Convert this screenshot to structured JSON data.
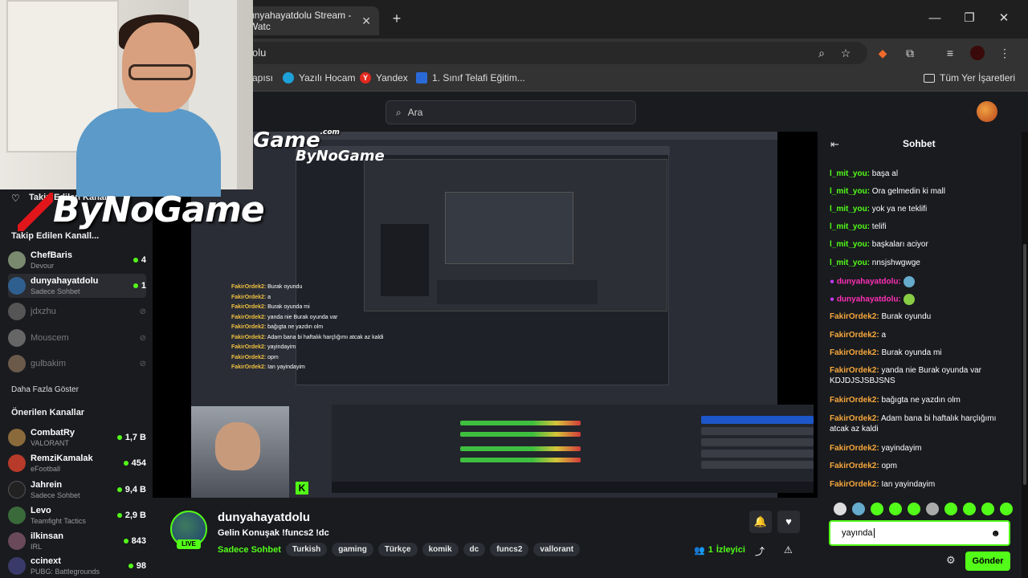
{
  "browser": {
    "tab_title": "unyahayatdolu Stream - Watc",
    "address": "olu",
    "bookmarks": [
      "apısı",
      "Yazılı Hocam",
      "Yandex",
      "1. Sınıf Telafi Eğitim...",
      "Tüm Yer İşaretleri"
    ]
  },
  "header": {
    "search_placeholder": "Ara"
  },
  "overlay": {
    "brand": "ByNoGame",
    "small_logo": "Game",
    "small_logo_com": ".com"
  },
  "sidebar": {
    "followed_title_overlay": "Takip Edilen Kanallar",
    "followed_title": "Takip Edilen Kanall...",
    "followed": [
      {
        "name": "ChefBaris",
        "sub": "Devour",
        "count": "4",
        "live": true,
        "avatar_color": "#7a8a6f"
      },
      {
        "name": "dunyahayatdolu",
        "sub": "Sadece Sohbet",
        "count": "1",
        "live": true,
        "avatar_color": "#2f5f8f"
      },
      {
        "name": "jdxzhu",
        "sub": "",
        "count": "",
        "live": false,
        "avatar_color": "#555"
      },
      {
        "name": "Mouscem",
        "sub": "",
        "count": "",
        "live": false,
        "avatar_color": "#666"
      },
      {
        "name": "gulbakim",
        "sub": "",
        "count": "",
        "live": false,
        "avatar_color": "#6b5a4a"
      }
    ],
    "show_more": "Daha Fazla Göster",
    "recommended_title": "Önerilen Kanallar",
    "recommended": [
      {
        "name": "CombatRy",
        "sub": "VALORANT",
        "count": "1,7 B",
        "avatar_color": "#8a6a3a"
      },
      {
        "name": "RemziKamalak",
        "sub": "eFootball",
        "count": "454",
        "avatar_color": "#b83a2a"
      },
      {
        "name": "Jahrein",
        "sub": "Sadece Sohbet",
        "count": "9,4 B",
        "avatar_color": "#222"
      },
      {
        "name": "Levo",
        "sub": "Teamfight Tactics",
        "count": "2,9 B",
        "avatar_color": "#3a6a3a"
      },
      {
        "name": "ilkinsan",
        "sub": "IRL",
        "count": "843",
        "avatar_color": "#6a4a5a"
      },
      {
        "name": "ccinext",
        "sub": "PUBG: Battlegrounds",
        "count": "98",
        "avatar_color": "#3a3a6a"
      }
    ]
  },
  "obs": {
    "chat_lines": [
      [
        "FakirOrdek2:",
        "Burak oyundu"
      ],
      [
        "FakirOrdek2:",
        "a"
      ],
      [
        "FakirOrdek2:",
        "Burak oyunda mi"
      ],
      [
        "FakirOrdek2:",
        "yanda nie Burak oyunda var"
      ],
      [
        "FakirOrdek2:",
        "bağıgta ne yazdın olm"
      ],
      [
        "FakirOrdek2:",
        "Adam bana bi haftalık harçlığımı atcak az kaldi"
      ],
      [
        "FakirOrdek2:",
        "yayindayim"
      ],
      [
        "FakirOrdek2:",
        "opm"
      ],
      [
        "FakirOrdek2:",
        "Ian yayindayim"
      ]
    ]
  },
  "stream": {
    "channel": "dunyahayatdolu",
    "title": "Gelin Konuşak  !funcs2 !dc",
    "category": "Sadece Sohbet",
    "live_badge": "LIVE",
    "tags": [
      "Turkish",
      "gaming",
      "Türkçe",
      "komik",
      "dc",
      "funcs2",
      "vallorant"
    ],
    "viewers": "1",
    "viewers_label": "İzleyici"
  },
  "chat": {
    "title": "Sohbet",
    "messages": [
      {
        "user": "l_mit_you:",
        "text": "başa al",
        "type": "you"
      },
      {
        "user": "l_mit_you:",
        "text": "Ora gelmedin ki mall",
        "type": "you"
      },
      {
        "user": "l_mit_you:",
        "text": "yok ya ne teklifi",
        "type": "you"
      },
      {
        "user": "l_mit_you:",
        "text": "telifi",
        "type": "you"
      },
      {
        "user": "l_mit_you:",
        "text": "başkaları aciyor",
        "type": "you"
      },
      {
        "user": "l_mit_you:",
        "text": "nnsjshwgwge",
        "type": "you"
      },
      {
        "user": "dunyahayatdolu:",
        "text": "",
        "type": "dun"
      },
      {
        "user": "dunyahayatdolu:",
        "text": "",
        "type": "dun"
      },
      {
        "user": "FakirOrdek2:",
        "text": "Burak oyundu",
        "type": "fak"
      },
      {
        "user": "FakirOrdek2:",
        "text": "a",
        "type": "fak"
      },
      {
        "user": "FakirOrdek2:",
        "text": "Burak oyunda mi",
        "type": "fak"
      },
      {
        "user": "FakirOrdek2:",
        "text": "yanda nie Burak oyunda var KDJDJSJSBJSNS",
        "type": "fak"
      },
      {
        "user": "FakirOrdek2:",
        "text": "bağıgta ne yazdın olm",
        "type": "fak"
      },
      {
        "user": "FakirOrdek2:",
        "text": "Adam bana bi haftalık harçlığımı atcak az kaldi",
        "type": "fak"
      },
      {
        "user": "FakirOrdek2:",
        "text": "yayindayim",
        "type": "fak"
      },
      {
        "user": "FakirOrdek2:",
        "text": "opm",
        "type": "fak"
      },
      {
        "user": "FakirOrdek2:",
        "text": "Ian yayindayim",
        "type": "fak"
      }
    ],
    "input_value": "yayında",
    "send_label": "Gönder"
  }
}
